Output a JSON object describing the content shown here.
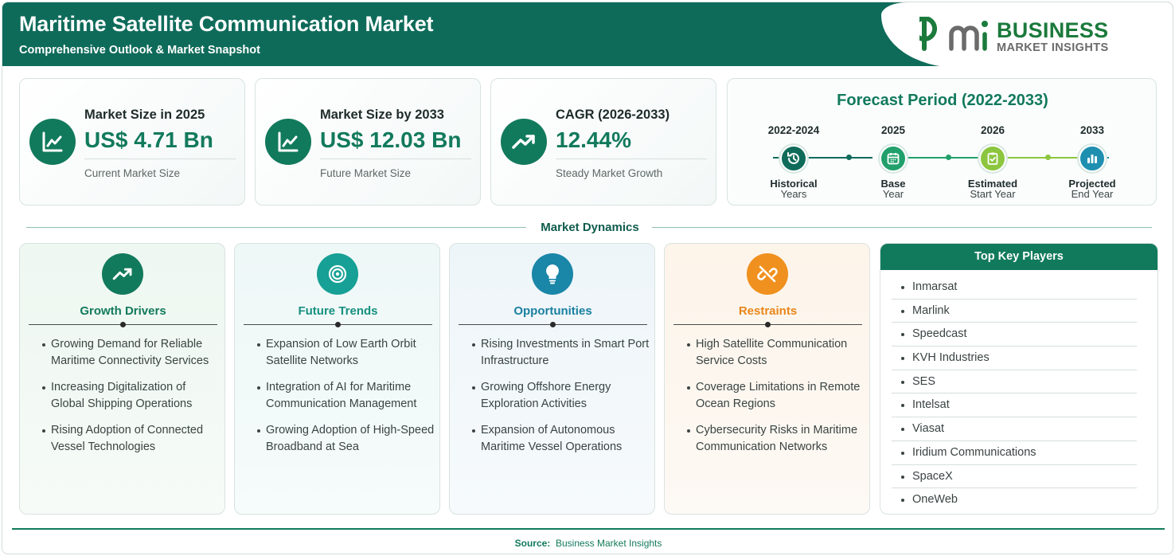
{
  "header": {
    "title": "Maritime Satellite Communication Market",
    "subtitle": "Comprehensive Outlook & Market Snapshot"
  },
  "logo": {
    "mark": "bmi",
    "line1": "BUSINESS",
    "line2": "MARKET INSIGHTS",
    "colors": {
      "green": "#1b7a3c",
      "gray": "#6b6b6b"
    }
  },
  "stats": [
    {
      "label": "Market Size in 2025",
      "value": "US$ 4.71 Bn",
      "caption": "Current Market Size",
      "icon": "line-chart-icon"
    },
    {
      "label": "Market Size by 2033",
      "value": "US$ 12.03 Bn",
      "caption": "Future Market Size",
      "icon": "line-chart-icon"
    },
    {
      "label": "CAGR (2026-2033)",
      "value": "12.44%",
      "caption": "Steady Market Growth",
      "icon": "trending-up-icon"
    }
  ],
  "forecast": {
    "title": "Forecast Period (2022-2033)",
    "steps": [
      {
        "year": "2022-2024",
        "name": "Historical",
        "desc": "Years",
        "icon": "history-icon",
        "color": "#0e6b5a"
      },
      {
        "year": "2025",
        "name": "Base",
        "desc": "Year",
        "icon": "calendar-icon",
        "color": "#22a06b"
      },
      {
        "year": "2026",
        "name": "Estimated",
        "desc": "Start Year",
        "icon": "clipboard-check-icon",
        "color": "#8cc63f"
      },
      {
        "year": "2033",
        "name": "Projected",
        "desc": "End Year",
        "icon": "bar-chart-icon",
        "color": "#1f8fb0"
      }
    ]
  },
  "dynamics": {
    "title": "Market Dynamics",
    "cards": [
      {
        "title": "Growth Drivers",
        "icon": "trending-up-icon",
        "color": "#127a5c",
        "items": [
          "Growing Demand for Reliable Maritime Connectivity Services",
          "Increasing Digitalization of Global Shipping Operations",
          "Rising Adoption of Connected Vessel Technologies"
        ]
      },
      {
        "title": "Future Trends",
        "icon": "target-icon",
        "color": "#17a095",
        "items": [
          "Expansion of Low Earth Orbit Satellite Networks",
          "Integration of AI for Maritime Communication Management",
          "Growing Adoption of High-Speed Broadband at Sea"
        ]
      },
      {
        "title": "Opportunities",
        "icon": "lightbulb-icon",
        "color": "#1a86a8",
        "items": [
          "Rising Investments in Smart Port Infrastructure",
          "Growing Offshore Energy Exploration Activities",
          "Expansion of Autonomous Maritime Vessel Operations"
        ]
      },
      {
        "title": "Restraints",
        "icon": "broken-link-icon",
        "color": "#f0901e",
        "items": [
          "High Satellite Communication Service Costs",
          "Coverage Limitations in Remote Ocean Regions",
          "Cybersecurity Risks in Maritime Communication Networks"
        ]
      }
    ]
  },
  "players": {
    "title": "Top Key Players",
    "items": [
      "Inmarsat",
      "Marlink",
      "Speedcast",
      "KVH Industries",
      "SES",
      "Intelsat",
      "Viasat",
      "Iridium Communications",
      "SpaceX",
      "OneWeb"
    ]
  },
  "footer": {
    "source_label": "Source:",
    "source_value": "Business Market Insights"
  }
}
